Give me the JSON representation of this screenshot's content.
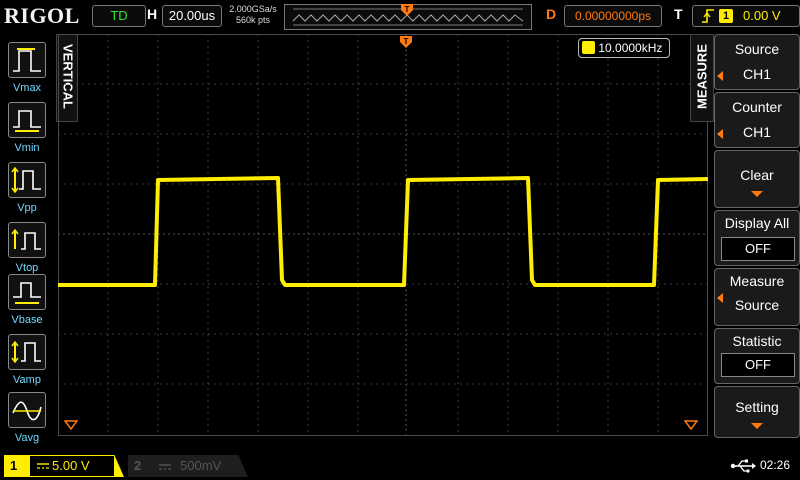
{
  "brand": "RIGOL",
  "top": {
    "trigger_status": "TD",
    "horiz_label": "H",
    "timebase": "20.00us",
    "sample_rate": "2.000GSa/s",
    "memory_depth": "560k pts",
    "delay_label": "D",
    "delay_value": "0.00000000ps",
    "trig_label": "T",
    "trig_source_num": "1",
    "trig_level": "0.00 V"
  },
  "left_tab": "VERTICAL",
  "left_items": [
    {
      "label": "Vmax",
      "icon": "vmax-icon"
    },
    {
      "label": "Vmin",
      "icon": "vmin-icon"
    },
    {
      "label": "Vpp",
      "icon": "vpp-icon"
    },
    {
      "label": "Vtop",
      "icon": "vtop-icon"
    },
    {
      "label": "Vbase",
      "icon": "vbase-icon"
    },
    {
      "label": "Vamp",
      "icon": "vamp-icon"
    },
    {
      "label": "Vavg",
      "icon": "vavg-icon"
    }
  ],
  "frequency_readout": "10.0000kHz",
  "right_tab": "MEASURE",
  "menu": {
    "source_title": "Source",
    "source_value": "CH1",
    "counter_title": "Counter",
    "counter_value": "CH1",
    "clear_label": "Clear",
    "display_all_title": "Display All",
    "display_all_value": "OFF",
    "measure_source_line1": "Measure",
    "measure_source_line2": "Source",
    "statistic_title": "Statistic",
    "statistic_value": "OFF",
    "setting_label": "Setting"
  },
  "bottom": {
    "ch1_num": "1",
    "ch1_scale": "5.00 V",
    "ch2_num": "2",
    "ch2_scale": "500mV",
    "time": "02:26"
  },
  "colors": {
    "ch1": "#ffee00",
    "accent": "#ff7a10",
    "trigger_green": "#2ee62e",
    "icon_label": "#6fd8ff"
  }
}
